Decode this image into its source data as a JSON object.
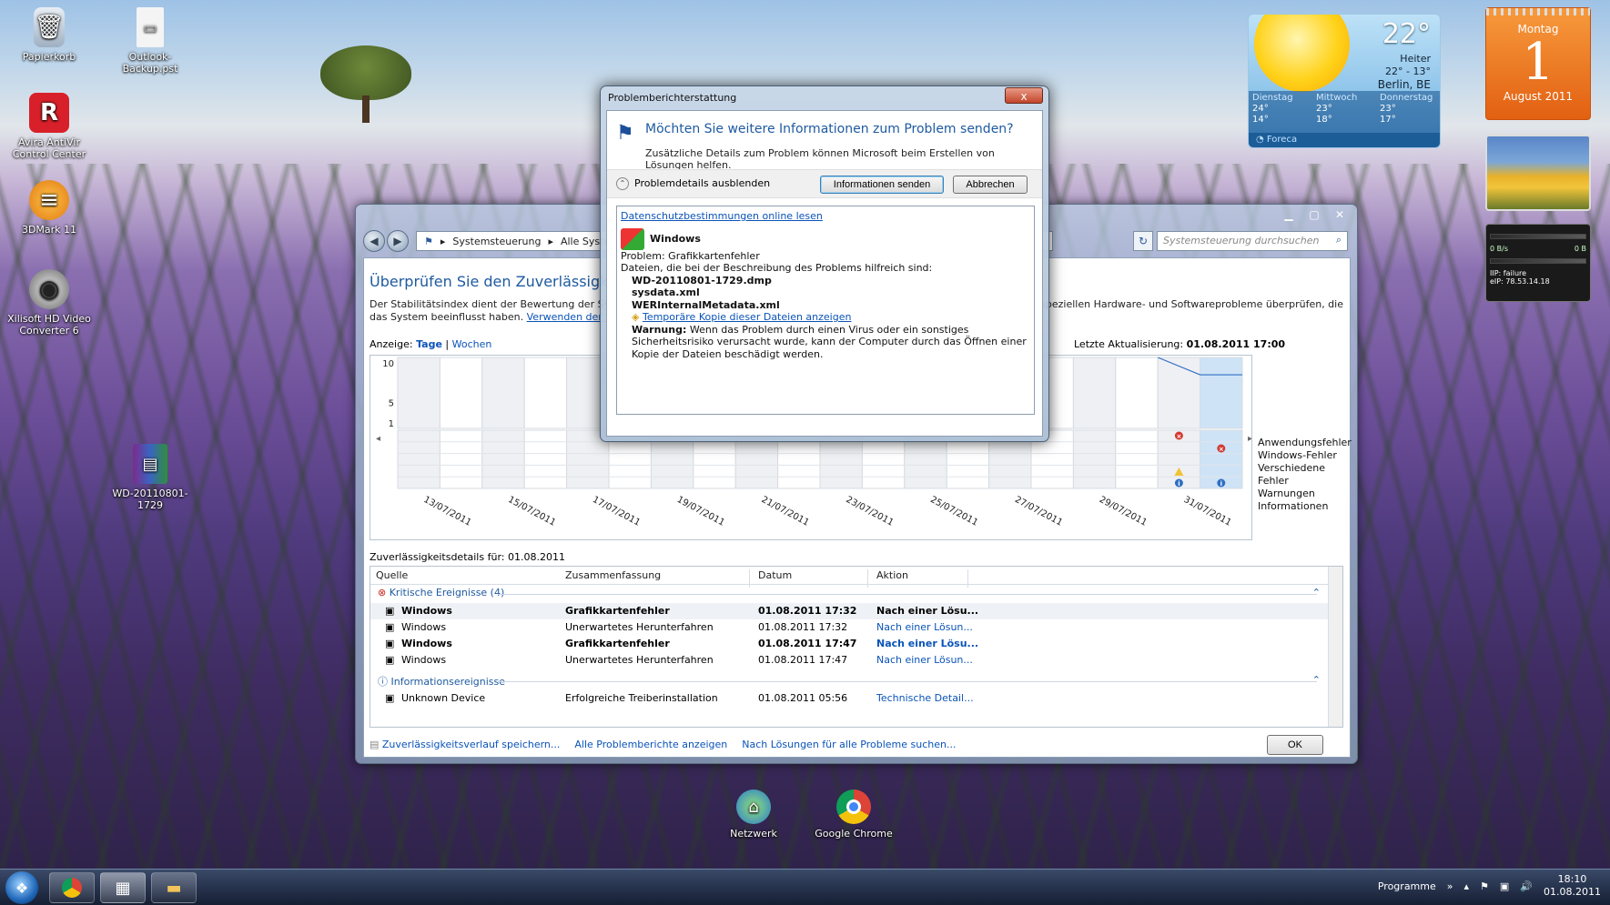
{
  "desktop": {
    "icons": [
      {
        "label": "Papierkorb"
      },
      {
        "label": "Outlook-Backup.pst"
      },
      {
        "label": "Avira AntiVir Control Center"
      },
      {
        "label": "3DMark 11"
      },
      {
        "label": "Xilisoft HD Video Converter 6"
      },
      {
        "label": "WD-20110801-1729"
      },
      {
        "label": "Netzwerk"
      },
      {
        "label": "Google Chrome"
      }
    ]
  },
  "weather": {
    "temp": "22°",
    "condition": "Heiter",
    "range": "22° - 13°",
    "city": "Berlin, BE",
    "days": [
      {
        "name": "Dienstag",
        "hi": "24°",
        "lo": "14°"
      },
      {
        "name": "Mittwoch",
        "hi": "23°",
        "lo": "18°"
      },
      {
        "name": "Donnerstag",
        "hi": "23°",
        "lo": "17°"
      }
    ],
    "brand": "Foreca"
  },
  "calendar": {
    "weekday": "Montag",
    "day": "1",
    "month": "August 2011"
  },
  "meter": {
    "ip": "IIP: failure",
    "eip": "eIP: 78.53.14.18",
    "speed_a": "0 B/s",
    "speed_b": "0 B"
  },
  "main_window": {
    "breadcrumb": [
      "Systemsteuerung",
      "Alle System"
    ],
    "search_placeholder": "Systemsteuerung durchsuchen",
    "title": "Überprüfen Sie den Zuverlässigkeits- ur",
    "description_start": "Der Stabilitätsindex dient der Bewertung der Systems",
    "description_end": "die speziellen Hardware- und Softwareprobleme überprüfen, die",
    "description_line2": "das System beeinflusst haben.",
    "description_link": "Verwenden der Zuver",
    "view_label": "Anzeige:",
    "view_days": "Tage",
    "view_weeks": "Wochen",
    "updated_label": "Letzte Aktualisierung:",
    "updated_value": "01.08.2011 17:00",
    "legend": [
      "Anwendungsfehler",
      "Windows-Fehler",
      "Verschiedene Fehler",
      "Warnungen",
      "Informationen"
    ],
    "details_label": "Zuverlässigkeitsdetails für: 01.08.2011",
    "columns": [
      "Quelle",
      "Zusammenfassung",
      "Datum",
      "Aktion"
    ],
    "group_critical": "Kritische Ereignisse (4)",
    "group_info": "Informationsereignisse",
    "rows_critical": [
      {
        "source": "Windows",
        "summary": "Grafikkartenfehler",
        "date": "01.08.2011 17:32",
        "action": "Nach einer Lösu...",
        "bold": true
      },
      {
        "source": "Windows",
        "summary": "Unerwartetes Herunterfahren",
        "date": "01.08.2011 17:32",
        "action": "Nach einer Lösun...",
        "bold": false
      },
      {
        "source": "Windows",
        "summary": "Grafikkartenfehler",
        "date": "01.08.2011 17:47",
        "action": "Nach einer Lösu...",
        "bold": true
      },
      {
        "source": "Windows",
        "summary": "Unerwartetes Herunterfahren",
        "date": "01.08.2011 17:47",
        "action": "Nach einer Lösun...",
        "bold": false
      }
    ],
    "rows_info": [
      {
        "source": "Unknown Device",
        "summary": "Erfolgreiche Treiberinstallation",
        "date": "01.08.2011 05:56",
        "action": "Technische Detail..."
      }
    ],
    "bottom_links": [
      "Zuverlässigkeitsverlauf speichern...",
      "Alle Problemberichte anzeigen",
      "Nach Lösungen für alle Probleme suchen..."
    ],
    "ok": "OK"
  },
  "chart_data": {
    "type": "line",
    "x": [
      "13/07/2011",
      "15/07/2011",
      "17/07/2011",
      "19/07/2011",
      "21/07/2011",
      "23/07/2011",
      "25/07/2011",
      "27/07/2011",
      "29/07/2011",
      "31/07/2011"
    ],
    "y_ticks": [
      "10",
      "5",
      "1"
    ],
    "ylim": [
      1,
      10
    ],
    "stability_segment": [
      {
        "day": "31/07/2011",
        "value": 10
      },
      {
        "day": "01/08/2011",
        "value": 7.8
      }
    ]
  },
  "dialog": {
    "title": "Problemberichterstattung",
    "close": "x",
    "question": "Möchten Sie weitere Informationen zum Problem senden?",
    "subtitle": "Zusätzliche Details zum Problem können Microsoft beim Erstellen von Lösungen helfen.",
    "toggle_label": "Problemdetails ausblenden",
    "send": "Informationen senden",
    "cancel": "Abbrechen",
    "privacy_link": "Datenschutzbestimmungen online lesen",
    "app": "Windows",
    "problem": "Problem: Grafikkartenfehler",
    "files_intro": "Dateien, die bei der Beschreibung des Problems hilfreich sind:",
    "files": [
      "WD-20110801-1729.dmp",
      "sysdata.xml",
      "WERInternalMetadata.xml"
    ],
    "temp_link": "Temporäre Kopie dieser Dateien anzeigen",
    "warning_label": "Warnung:",
    "warning_text": "Wenn das Problem durch einen Virus oder ein sonstiges Sicherheitsrisiko verursacht wurde, kann der Computer durch das Öffnen einer Kopie der Dateien beschädigt werden."
  },
  "taskbar": {
    "programs_label": "Programme",
    "time": "18:10",
    "date": "01.08.2011"
  }
}
